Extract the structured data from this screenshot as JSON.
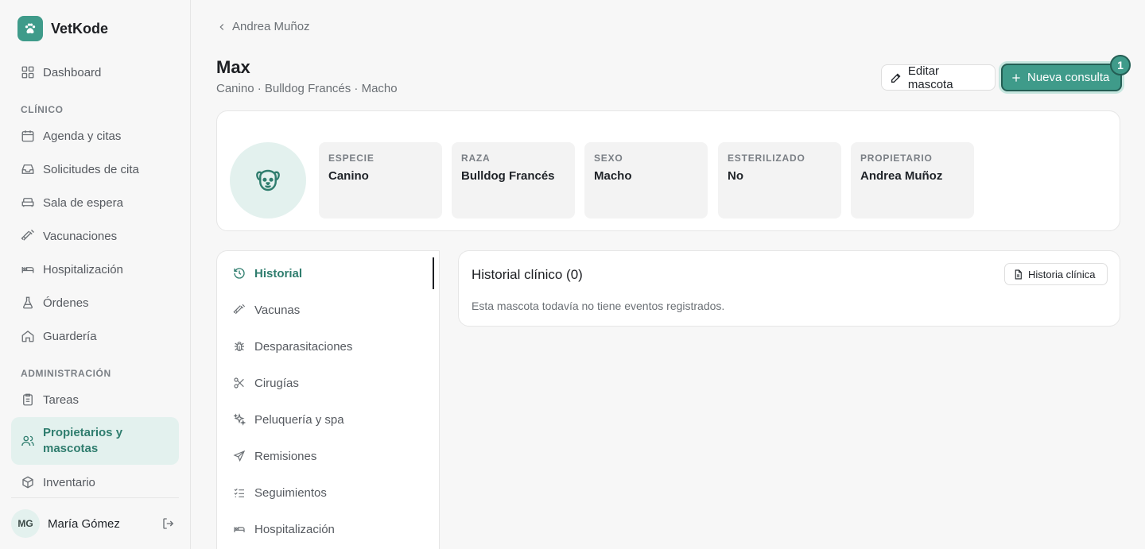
{
  "app": {
    "name": "VetKode"
  },
  "sidebar": {
    "dashboard": "Dashboard",
    "section_clinico": "CLÍNICO",
    "clinico_items": [
      "Agenda y citas",
      "Solicitudes de cita",
      "Sala de espera",
      "Vacunaciones",
      "Hospitalización",
      "Órdenes",
      "Guardería"
    ],
    "section_admin": "ADMINISTRACIÓN",
    "admin_items": [
      "Tareas",
      "Propietarios y mascotas",
      "Inventario"
    ],
    "active_item": "Propietarios y mascotas",
    "user": {
      "initials": "MG",
      "name": "María Gómez"
    }
  },
  "breadcrumb": {
    "back_label": "Andrea Muñoz"
  },
  "pet": {
    "name": "Max",
    "subtitle": "Canino · Bulldog Francés · Macho",
    "fields": [
      {
        "label": "ESPECIE",
        "value": "Canino"
      },
      {
        "label": "RAZA",
        "value": "Bulldog Francés"
      },
      {
        "label": "SEXO",
        "value": "Macho"
      },
      {
        "label": "ESTERILIZADO",
        "value": "No"
      },
      {
        "label": "PROPIETARIO",
        "value": "Andrea Muñoz"
      }
    ]
  },
  "actions": {
    "edit_label": "Editar mascota",
    "new_consult_label": "Nueva consulta",
    "badge_count": "1"
  },
  "tabs": {
    "items": [
      "Historial",
      "Vacunas",
      "Desparasitaciones",
      "Cirugías",
      "Peluquería y spa",
      "Remisiones",
      "Seguimientos",
      "Hospitalización"
    ],
    "active": "Historial"
  },
  "history": {
    "title": "Historial clínico (0)",
    "empty_message": "Esta mascota todavía no tiene eventos registrados.",
    "button_label": "Historia clínica"
  },
  "colors": {
    "accent": "#3f9b8a",
    "accent_light": "#e3f1ee",
    "accent_dark": "#245e54"
  }
}
